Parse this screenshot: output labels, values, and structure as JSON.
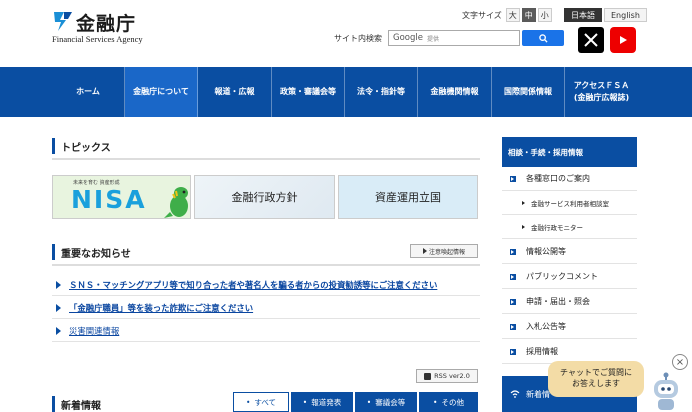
{
  "header": {
    "logo_jp": "金融庁",
    "logo_en": "Financial Services Agency",
    "font_size_label": "文字サイズ",
    "font_sizes": [
      "大",
      "中",
      "小"
    ],
    "font_size_selected": "中",
    "lang_ja": "日本語",
    "lang_en": "English",
    "search_label": "サイト内検索",
    "search_engine": "Google",
    "search_placeholder": "提供"
  },
  "nav": {
    "items": [
      "ホーム",
      "金融庁について",
      "報道・広報",
      "政策・審議会等",
      "法令・指針等",
      "金融機関情報",
      "国際関係情報"
    ],
    "access_line1": "アクセスＦＳＡ",
    "access_line2": "(金融庁広報誌)",
    "active": "金融庁について"
  },
  "topics": {
    "title": "トピックス",
    "banners": {
      "nisa_tagline": "未来を育む 資産形成",
      "nisa_word": "NISA",
      "policy": "金融行政方針",
      "asset": "資産運用立国"
    }
  },
  "notices": {
    "title": "重要なお知らせ",
    "alert_button": "注意喚起情報",
    "items": [
      "ＳＮＳ・マッチングアプリ等で知り合った者や著名人を騙る者からの投資勧誘等にご注意ください",
      "「金融庁職員」等を装った詐欺にご注意ください",
      "災害関連情報"
    ]
  },
  "news": {
    "title": "新着情報",
    "rss": "RSS ver2.0",
    "tabs": [
      "すべて",
      "報道発表",
      "審議会等",
      "その他"
    ],
    "selected_tab": "すべて"
  },
  "sidebar": {
    "head": "相談・手続・採用情報",
    "items": [
      "各種窓口のご案内",
      "金融サービス利用者相談室",
      "金融行政モニター",
      "情報公開等",
      "パブリックコメント",
      "申請・届出・照会",
      "入札公告等",
      "採用情報"
    ],
    "new": "新着情"
  },
  "chat": {
    "line1": "チャットでご質問に",
    "line2": "お答えします"
  },
  "colors": {
    "primary": "#0a4ea2",
    "nav_active": "#1a67c8",
    "link": "#0a46a0",
    "chat_bubble": "#f3dca6"
  }
}
